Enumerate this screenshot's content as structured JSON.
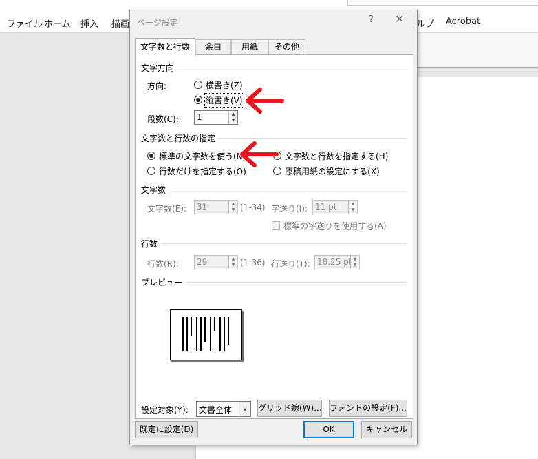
{
  "app": {
    "ribbon_tabs": [
      "ファイル",
      "ホーム",
      "挿入",
      "描画",
      "ルプ",
      "Acrobat"
    ]
  },
  "dialog": {
    "title": "ページ設定",
    "help": "?",
    "close": "✕",
    "tabs": [
      "文字数と行数",
      "余白",
      "用紙",
      "その他"
    ],
    "active_tab": "文字数と行数",
    "direction": {
      "section": "文字方向",
      "label": "方向:",
      "horizontal": "横書き(Z)",
      "vertical": "縦書き(V)",
      "selected": "縦書き(V)",
      "columns_label": "段数(C):",
      "columns_value": "1"
    },
    "grid_spec": {
      "section": "文字数と行数の指定",
      "options": [
        "標準の文字数を使う(N)",
        "文字数と行数を指定する(H)",
        "行数だけを指定する(O)",
        "原稿用紙の設定にする(X)"
      ],
      "selected": "標準の文字数を使う(N)"
    },
    "chars": {
      "section": "文字数",
      "count_label": "文字数(E):",
      "count_value": "31",
      "count_range": "(1-34)",
      "pitch_label": "字送り(I):",
      "pitch_value": "11 pt",
      "std_pitch_label": "標準の字送りを使用する(A)"
    },
    "lines": {
      "section": "行数",
      "count_label": "行数(R):",
      "count_value": "29",
      "count_range": "(1-36)",
      "pitch_label": "行送り(T):",
      "pitch_value": "18.25 pt"
    },
    "preview": {
      "section": "プレビュー"
    },
    "apply": {
      "label": "設定対象(Y):",
      "value": "文書全体",
      "grid_button": "グリッド線(W)...",
      "font_button": "フォントの設定(F)..."
    },
    "footer": {
      "default_button": "既定に設定(D)",
      "ok": "OK",
      "cancel": "キャンセル"
    }
  },
  "colors": {
    "annotation_arrow": "#e8141e",
    "default_button_border": "#0078d7"
  }
}
